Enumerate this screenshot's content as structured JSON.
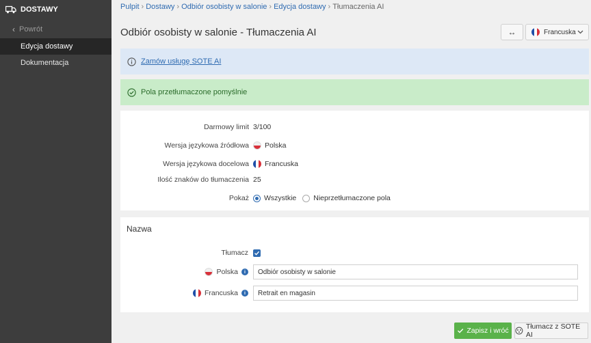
{
  "sidebar": {
    "header": "DOSTAWY",
    "back": "Powrót",
    "items": [
      {
        "label": "Edycja dostawy",
        "active": true
      },
      {
        "label": "Dokumentacja",
        "active": false
      }
    ]
  },
  "breadcrumb": {
    "items": [
      "Pulpit",
      "Dostawy",
      "Odbiór osobisty w salonie",
      "Edycja dostawy"
    ],
    "current": "Tłumaczenia AI"
  },
  "page": {
    "title": "Odbiór osobisty w salonie - Tłumaczenia AI"
  },
  "toolbar": {
    "swap_symbol": "↔",
    "language_selected": "Francuska"
  },
  "alerts": {
    "info_link": "Zamów usługę SOTE AI",
    "success": "Pola przetłumaczone pomyślnie"
  },
  "summary": {
    "free_limit_label": "Darmowy limit",
    "free_limit_value": "3/100",
    "source_label": "Wersja językowa źródłowa",
    "source_value": "Polska",
    "target_label": "Wersja językowa docelowa",
    "target_value": "Francuska",
    "chars_label": "Ilość znaków do tłumaczenia",
    "chars_value": "25",
    "show_label": "Pokaż",
    "show_options": [
      {
        "label": "Wszystkie",
        "selected": true
      },
      {
        "label": "Nieprzetłumaczone pola",
        "selected": false
      }
    ]
  },
  "name_section": {
    "title": "Nazwa",
    "translate_label": "Tłumacz",
    "translate_checked": true,
    "polish_label": "Polska",
    "polish_value": "Odbiór osobisty w salonie",
    "french_label": "Francuska",
    "french_value": "Retrait en magasin"
  },
  "actions": {
    "save_label": "Zapisz i wróć",
    "ai_label": "Tłumacz z SOTE AI"
  },
  "colors": {
    "sidebar_bg": "#3d3d3d",
    "link": "#2f6bb1",
    "success_bg": "#c9ecc9",
    "info_bg": "#dde8f6",
    "save_button": "#5ab24a"
  }
}
